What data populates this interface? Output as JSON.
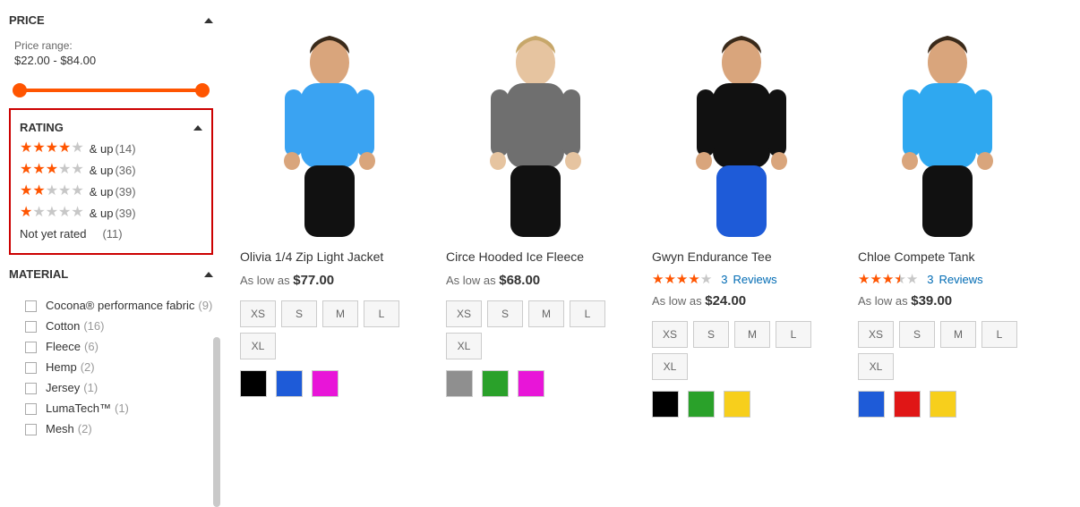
{
  "filters": {
    "price": {
      "title": "Price",
      "label": "Price range:",
      "range": "$22.00 - $84.00"
    },
    "rating": {
      "title": "Rating",
      "and_up": "& up",
      "items": [
        {
          "stars": 4,
          "count": "(14)"
        },
        {
          "stars": 3,
          "count": "(36)"
        },
        {
          "stars": 2,
          "count": "(39)"
        },
        {
          "stars": 1,
          "count": "(39)"
        }
      ],
      "not_yet_rated_label": "Not yet rated",
      "not_yet_rated_count": "(11)"
    },
    "material": {
      "title": "Material",
      "options": [
        {
          "label": "Cocona® performance fabric",
          "count": "(9)"
        },
        {
          "label": "Cotton",
          "count": "(16)"
        },
        {
          "label": "Fleece",
          "count": "(6)"
        },
        {
          "label": "Hemp",
          "count": "(2)"
        },
        {
          "label": "Jersey",
          "count": "(1)"
        },
        {
          "label": "LumaTech™",
          "count": "(1)"
        },
        {
          "label": "Mesh",
          "count": "(2)"
        }
      ]
    }
  },
  "as_low_as": "As low as",
  "reviews_label": "Reviews",
  "products": [
    {
      "name": "Olivia 1/4 Zip Light Jacket",
      "price": "$77.00",
      "sizes": [
        "XS",
        "S",
        "M",
        "L",
        "XL"
      ],
      "colors": [
        "#000000",
        "#1e5bd8",
        "#e815d8"
      ]
    },
    {
      "name": "Circe Hooded Ice Fleece",
      "price": "$68.00",
      "sizes": [
        "XS",
        "S",
        "M",
        "L",
        "XL"
      ],
      "colors": [
        "#8f8f8f",
        "#2aa12a",
        "#e815d8"
      ]
    },
    {
      "name": "Gwyn Endurance Tee",
      "price": "$24.00",
      "reviews": {
        "stars": 4,
        "half": false,
        "count": "3"
      },
      "sizes": [
        "XS",
        "S",
        "M",
        "L",
        "XL"
      ],
      "colors": [
        "#000000",
        "#2aa12a",
        "#f7cf1c"
      ]
    },
    {
      "name": "Chloe Compete Tank",
      "price": "$39.00",
      "reviews": {
        "stars": 3,
        "half": true,
        "count": "3"
      },
      "sizes": [
        "XS",
        "S",
        "M",
        "L",
        "XL"
      ],
      "colors": [
        "#1e5bd8",
        "#e01616",
        "#f7cf1c"
      ]
    }
  ]
}
